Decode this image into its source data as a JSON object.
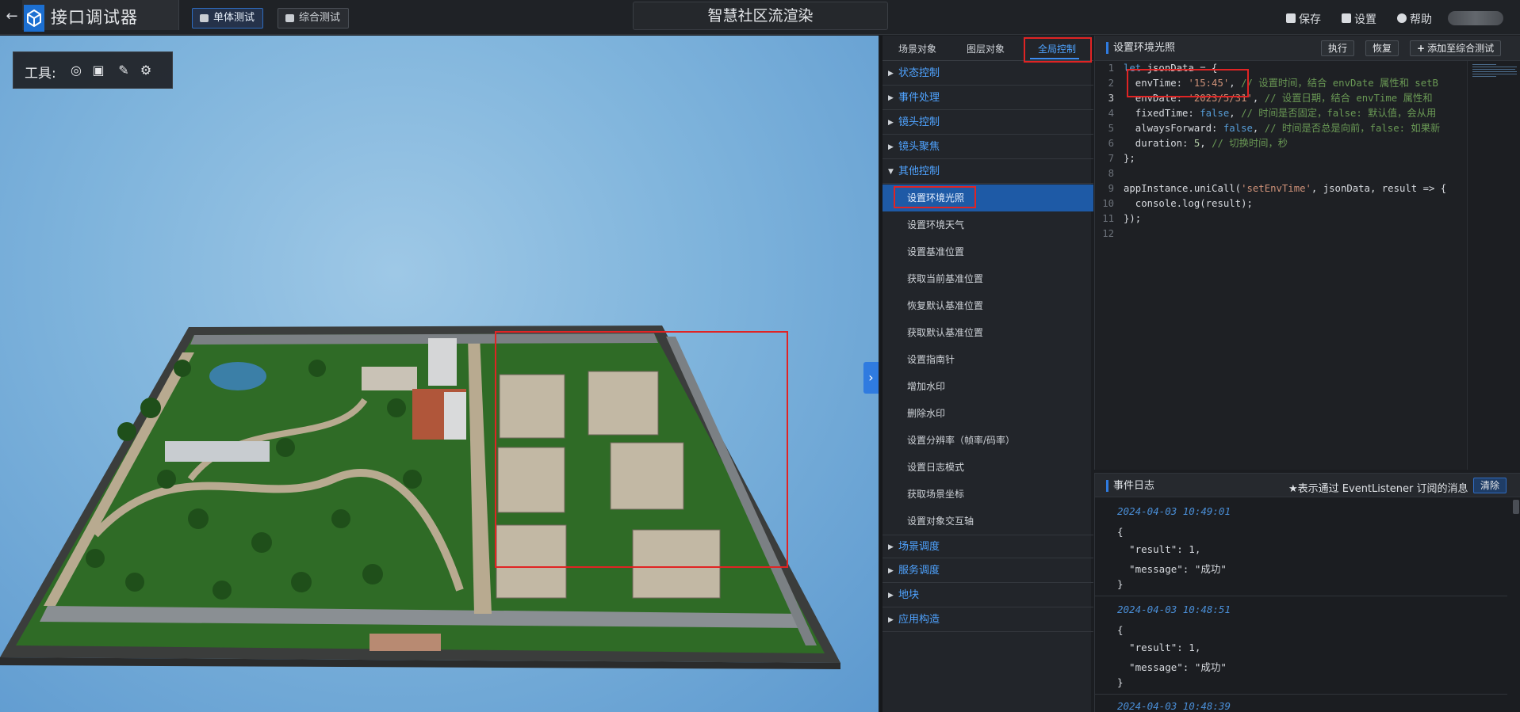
{
  "app": {
    "name": "接口调试器",
    "scene_title": "智慧社区流渲染"
  },
  "header": {
    "tabs": [
      {
        "label": "单体测试",
        "active": true
      },
      {
        "label": "综合测试",
        "active": false
      }
    ],
    "actions": {
      "save": "保存",
      "settings": "设置",
      "help": "帮助"
    }
  },
  "toolbar": {
    "label": "工具:"
  },
  "tree": {
    "tabs": [
      "场景对象",
      "图层对象",
      "全局控制"
    ],
    "active_tab": "全局控制",
    "categories": [
      {
        "label": "状态控制",
        "expanded": false
      },
      {
        "label": "事件处理",
        "expanded": false
      },
      {
        "label": "镜头控制",
        "expanded": false
      },
      {
        "label": "镜头聚焦",
        "expanded": false
      },
      {
        "label": "其他控制",
        "expanded": true
      },
      {
        "label": "场景调度",
        "expanded": false
      },
      {
        "label": "服务调度",
        "expanded": false
      },
      {
        "label": "地块",
        "expanded": false
      },
      {
        "label": "应用构造",
        "expanded": false
      }
    ],
    "other_items": [
      "设置环境光照",
      "设置环境天气",
      "设置基准位置",
      "获取当前基准位置",
      "恢复默认基准位置",
      "获取默认基准位置",
      "设置指南针",
      "增加水印",
      "删除水印",
      "设置分辨率（帧率/码率）",
      "设置日志模式",
      "获取场景坐标",
      "设置对象交互轴"
    ],
    "selected_item": "设置环境光照"
  },
  "editor": {
    "title": "设置环境光照",
    "buttons": {
      "run": "执行",
      "restore": "恢复",
      "add": "添加至综合测试"
    },
    "current_line": 3,
    "lines": [
      "let jsonData = {",
      "  envTime: '15:45', // 设置时间，结合 envDate 属性和 setB",
      "  envDate: '2023/5/31', // 设置日期，结合 envTime 属性和",
      "  fixedTime: false, // 时间是否固定，false: 默认值，会从用",
      "  alwaysForward: false, // 时间是否总是向前，false: 如果新",
      "  duration: 5, // 切换时间，秒",
      "};",
      "",
      "appInstance.uniCall('setEnvTime', jsonData, result => {",
      "  console.log(result);",
      "});",
      ""
    ]
  },
  "log": {
    "title": "事件日志",
    "note": "★表示通过 EventListener 订阅的消息",
    "clear": "清除",
    "entries": [
      {
        "time": "2024-04-03 10:49:01",
        "body": [
          "{",
          "  \"result\": 1,",
          "  \"message\": \"成功\"",
          "}"
        ]
      },
      {
        "time": "2024-04-03 10:48:51",
        "body": [
          "{",
          "  \"result\": 1,",
          "  \"message\": \"成功\"",
          "}"
        ]
      },
      {
        "time": "2024-04-03 10:48:39",
        "body": []
      }
    ]
  },
  "colors": {
    "accent": "#2f7be0",
    "highlight": "#e02424",
    "link": "#4fa3ff"
  },
  "icons": {
    "tools": [
      "location-target-icon",
      "frame-select-icon",
      "pen-icon",
      "gear-cluster-icon"
    ]
  }
}
